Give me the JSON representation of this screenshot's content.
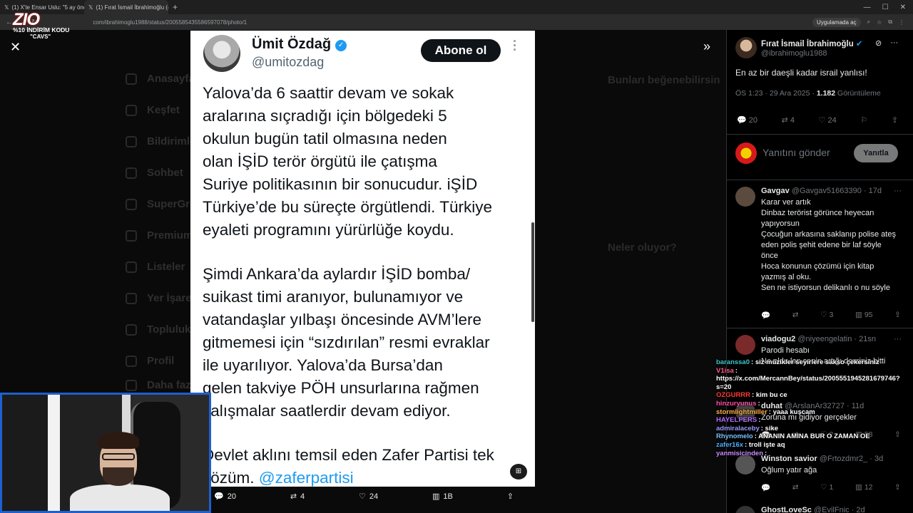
{
  "browser": {
    "tabs": [
      {
        "label": "(1) X'te Ensar Uslu: \"5 ay önce h",
        "active": false
      },
      {
        "label": "(1) Fırat İsmail İbrahimoğlu (@",
        "active": true
      }
    ],
    "url": "com/ibrahimoglu1988/status/2005585435586597078/photo/1",
    "open_in_app": "Uygulamada aç"
  },
  "promo": {
    "logo": "ZIO",
    "code": "%10 İNDİRİM KODU",
    "tag": "\"CAVS\""
  },
  "background_nav": [
    "Anasayfa",
    "Keşfet",
    "Bildirimler",
    "Sohbet",
    "SuperGrok",
    "Premium",
    "Listeler",
    "Yer İşaretleri",
    "Topluluklar",
    "Profil",
    "Daha fazla"
  ],
  "background_side": {
    "follow_title": "Bunları beğenebilirsin",
    "trends_title": "Neler oluyor?"
  },
  "image_tweet": {
    "name": "Ümit Özdağ",
    "handle": "@umitozdag",
    "follow_label": "Abone ol",
    "paragraphs": [
      "Yalova’da 6 saattir devam ve sokak\naralarına sıçradığı için bölgedeki 5\nokulun bugün tatil olmasına neden\nolan İŞİD terör örgütü ile çatışma\nSuriye politikasının bir sonucudur. iŞİD\nTürkiye’de bu süreçte örgütlendi. Türkiye\neyaleti programını yürürlüğe koydu.",
      "Şimdi Ankara’da aylardır İŞİD bomba/\nsuikast timi aranıyor, bulunamıyor ve\nvatandaşlar yılbaşı öncesinde AVM’lere\ngitmemesi için “sızdırılan” resmi evraklar\nile uyarılıyor. Yalova’da Bursa’dan\ngelen takviye PÖH unsurlarına rağmen\nçalışmalar saatlerdir devam ediyor."
    ],
    "last_line_1": "Devlet aklını temsil eden Zafer Partisi tek",
    "last_line_2_prefix": "çözüm. ",
    "last_line_2_mention": "@zaferpartisi"
  },
  "image_actions": {
    "replies": "20",
    "reposts": "4",
    "likes": "24",
    "views": "1B"
  },
  "pane": {
    "author_name": "Fırat İsmail İbrahimoğlu",
    "author_handle": "@ibrahimoglu1988",
    "text": "En az bir daeşli kadar israil yanlısı!",
    "time": "ÖS 1:23 · 29 Ara 2025 · ",
    "views_count": "1.182",
    "views_label": " Görüntüleme",
    "stats": {
      "replies": "20",
      "reposts": "4",
      "likes": "24"
    },
    "reply_placeholder": "Yanıtını gönder",
    "reply_button": "Yanıtla"
  },
  "comments": [
    {
      "name": "Gavgav",
      "handle": "@Gavgav51663390 · 17d",
      "text": "Karar ver artık\nDinbaz terörist görünce heyecan yapıyorsun\nÇocuğun arkasına saklanıp polise ateş eden polis şehit edene bir laf söyle önce\nHoca konunun çözümü için kitap yazmış al oku.\nSen ne istiyorsun delikanlı o nu söyle",
      "replies": "",
      "reposts": "",
      "likes": "3",
      "views": "95"
    },
    {
      "name": "viadogu2",
      "handle": "@niyeengelatin · 21sn",
      "text": "Parodi hesabı\nNe oldu lan senin artığı devriniz bitti",
      "replies": "",
      "reposts": "",
      "likes": "",
      "views": ""
    },
    {
      "name": "duhat",
      "handle": "@ArslanAr32727 · 11d",
      "text": "Zoruna mı gidiyor gerçekler",
      "replies": "",
      "reposts": "",
      "likes": "2",
      "views": "58"
    },
    {
      "name": "Winston savior",
      "handle": "@Frtozdmr2_ · 3d",
      "text": "Oğlum yatır ağa",
      "replies": "",
      "reposts": "",
      "likes": "1",
      "views": "12"
    },
    {
      "name": "GhostLoveSc",
      "handle": "@EvilFnic · 2d",
      "text": "",
      "replies": "",
      "reposts": "",
      "likes": "",
      "views": ""
    }
  ],
  "chat": [
    {
      "user": "baranssa0",
      "color": "#3cc8c8",
      "msg": ": siz müzikler seyirlere sakso çekersiniz"
    },
    {
      "user": "V1isa",
      "color": "#ff5b8a",
      "msg": ":"
    },
    {
      "user": "",
      "color": "#ffffff",
      "msg": "https://x.com/MercannBey/status/2005551945281679746?s=20"
    },
    {
      "user": "OZGURRR",
      "color": "#ff3b30",
      "msg": ": kim bu ce"
    },
    {
      "user": "hinzuryunus",
      "color": "#ff4fa8",
      "msg": ":"
    },
    {
      "user": "stormlightmiller",
      "color": "#ffb347",
      "msg": ": yaaa kuşcam"
    },
    {
      "user": "HAYELPERS",
      "color": "#b36bff",
      "msg": ":"
    },
    {
      "user": "admiralaceby",
      "color": "#9a9aff",
      "msg": ": sike"
    },
    {
      "user": "Rhynomelo",
      "color": "#7ac1ff",
      "msg": ": ANANIN AMINA BUR O ZAMAN OE"
    },
    {
      "user": "zafer16x",
      "color": "#4fb0ff",
      "msg": ": troll işte aq"
    },
    {
      "user": "yanmisicinden",
      "color": "#c98cff",
      "msg": ":"
    }
  ]
}
